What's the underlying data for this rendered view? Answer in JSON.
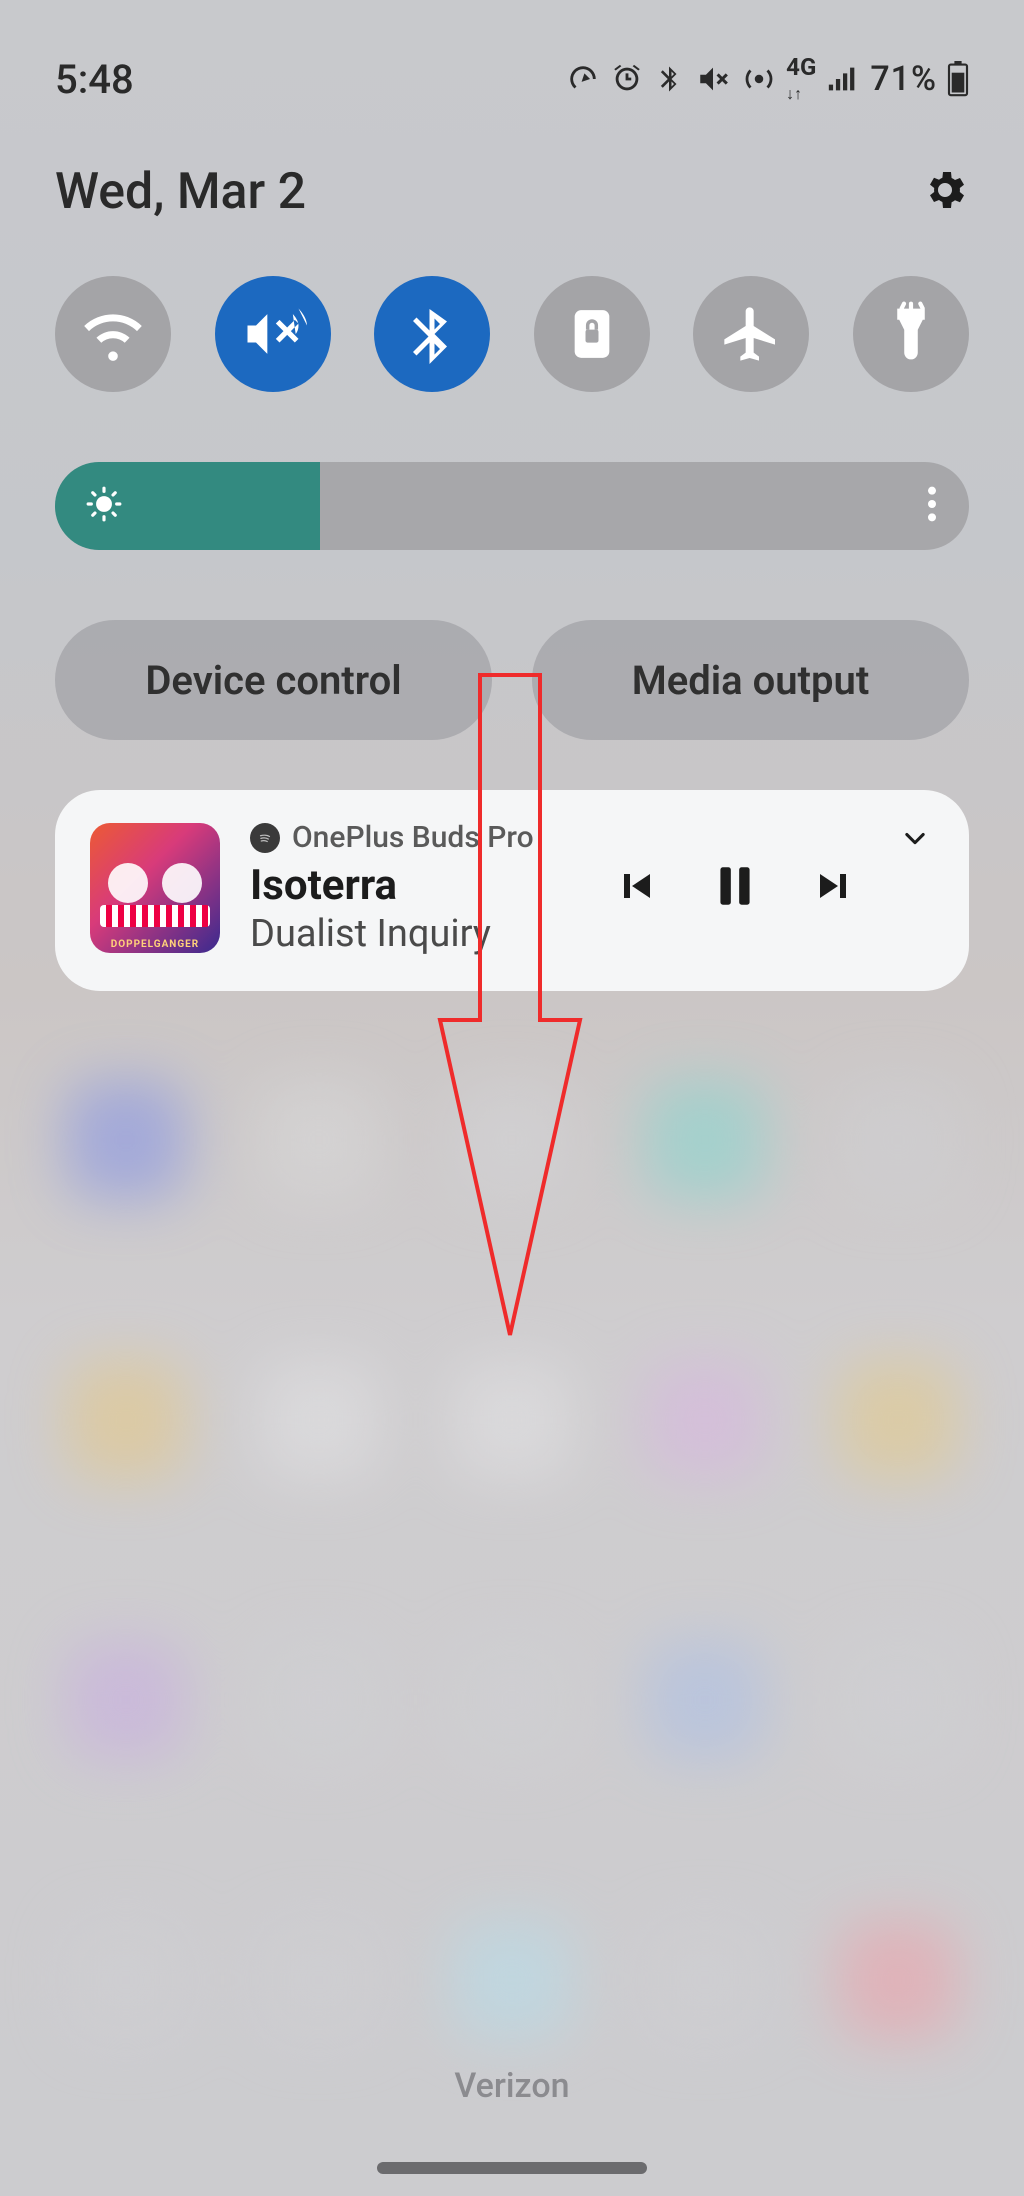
{
  "status": {
    "time": "5:48",
    "battery_pct": "71%",
    "network_label": "4G"
  },
  "header": {
    "date": "Wed, Mar 2"
  },
  "brightness": {
    "value_pct": 29
  },
  "pills": {
    "device_control": "Device control",
    "media_output": "Media output"
  },
  "media": {
    "device": "OnePlus Buds Pro",
    "song": "Isoterra",
    "artist": "Dualist Inquiry",
    "album_footer": "DOPPELGANGER"
  },
  "footer": {
    "carrier": "Verizon"
  },
  "colors": {
    "toggle_on": "#1c69c0",
    "toggle_off": "#a4a4a7",
    "slider_fill": "#338a80",
    "annotation": "#ef2b2b"
  },
  "toggles": [
    {
      "name": "wifi",
      "active": false
    },
    {
      "name": "vibrate",
      "active": true
    },
    {
      "name": "bluetooth",
      "active": true
    },
    {
      "name": "rotation-lock",
      "active": false
    },
    {
      "name": "airplane",
      "active": false
    },
    {
      "name": "flashlight",
      "active": false
    }
  ]
}
